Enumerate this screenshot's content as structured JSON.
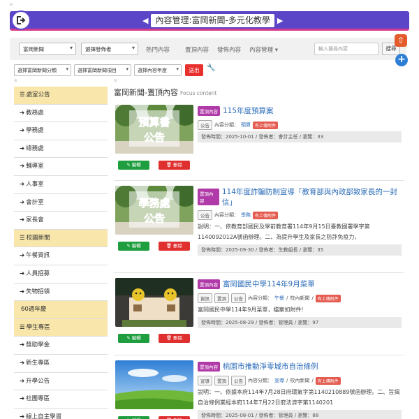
{
  "header": {
    "title": "內容管理:富岡新聞-多元化教學",
    "back_icon": "exit-icon",
    "left_arrow": "◀",
    "right_arrow": "▶",
    "colors": {
      "bar": "#5b46c8",
      "accent_line": "#d63a8c"
    }
  },
  "toolbar": {
    "category_select": "富岡新聞",
    "publisher_select": "選擇發佈者",
    "nav": [
      "熱門內容",
      "置頂內容",
      "發佈內容",
      "內容管理"
    ],
    "search_placeholder": "輸入搜尋內容",
    "search_button": "搜尋"
  },
  "filters": {
    "category": "選擇富岡新聞分類",
    "item": "選擇富岡新聞項目",
    "year": "選擇內容年度",
    "send_button": "送出"
  },
  "sidebar": {
    "items": [
      {
        "label": "處室公告",
        "type": "category"
      },
      {
        "label": "教務處",
        "type": "link"
      },
      {
        "label": "學務處",
        "type": "link"
      },
      {
        "label": "總務處",
        "type": "link"
      },
      {
        "label": "輔導室",
        "type": "link"
      },
      {
        "label": "人事室",
        "type": "link"
      },
      {
        "label": "會計室",
        "type": "link"
      },
      {
        "label": "家長會",
        "type": "link"
      },
      {
        "label": "校園新聞",
        "type": "category"
      },
      {
        "label": "午餐資訊",
        "type": "link"
      },
      {
        "label": "人員招募",
        "type": "link"
      },
      {
        "label": "失物招領",
        "type": "link"
      },
      {
        "label": "60週年慶",
        "type": "plain"
      },
      {
        "label": "學生專區",
        "type": "category"
      },
      {
        "label": "獎助學金",
        "type": "link"
      },
      {
        "label": "新生專區",
        "type": "link"
      },
      {
        "label": "升學公告",
        "type": "link"
      },
      {
        "label": "社團專區",
        "type": "link"
      },
      {
        "label": "線上自主學習",
        "type": "link"
      }
    ]
  },
  "main": {
    "title": "富岡新聞-置頂內容",
    "subtitle": "Focus content",
    "edit_label": "編輯",
    "delete_label": "刪除",
    "top_badge": "置頂內容",
    "posts": [
      {
        "thumb_text": [
          "預算書",
          "公告"
        ],
        "title": "115年度預算案",
        "tags": [
          "公告"
        ],
        "category_label": "內容分類：",
        "category": "預算",
        "unit": "",
        "attachment": "有上傳附件",
        "desc": [],
        "info": "發佈時間：2025-10-01 / 發佈者：會計主任 / 瀏覽：33"
      },
      {
        "thumb_text": [
          "學務處",
          "公告"
        ],
        "title": "114年度詐騙防制宣導「教育部與內政部致家長的一封信」",
        "tags": [
          "公告"
        ],
        "category_label": "內容分類：",
        "category": "學務",
        "unit": "",
        "attachment": "有上傳附件",
        "desc": [
          "說明：一、依教育部國民及學前教育署114年9月15日臺教國署學字第1140092012A號函辦理。二、為提升學生及家長之防詐免疫力，"
        ],
        "info": "發佈時間：2025-09-30 / 發佈者：生教組長 / 瀏覽：35"
      },
      {
        "thumb_text": [],
        "title": "富岡國民中學114年9月菜單",
        "tags": [
          "資訊",
          "置頂",
          "公告"
        ],
        "category_label": "內容分類：",
        "category": "午餐",
        "unit": "校內新聞",
        "attachment": "有上傳附件",
        "desc": [
          "富岡國民中學114年9月菜單，檔案如附件!"
        ],
        "info": "發佈時間：2025-08-29 / 發佈者：管理員 / 瀏覽：97"
      },
      {
        "thumb_text": [],
        "title": "桃園市推動淨零城市自治條例",
        "tags": [
          "宣導",
          "置頂",
          "公告"
        ],
        "category_label": "內容分類：",
        "category": "宣導",
        "unit": "校內新聞",
        "attachment": "有上傳附件",
        "desc": [
          "說明：一、依據本府114年7月28日府環氣字第1140210889號函辦理。二、旨揭自治條例業經本府114年7月22日府法濟字第1140201"
        ],
        "info": "發佈時間：2025-08-01 / 發佈者：管理員 / 瀏覽：88"
      }
    ]
  }
}
